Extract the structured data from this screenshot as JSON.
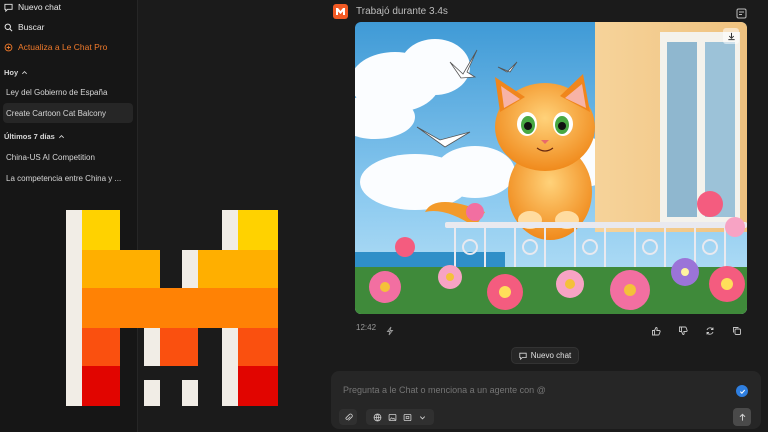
{
  "sidebar": {
    "new_chat": "Nuevo chat",
    "search": "Buscar",
    "upgrade": "Actualiza a Le Chat Pro",
    "today_label": "Hoy",
    "today_items": [
      "Ley del Gobierno de España",
      "Create Cartoon Cat Balcony"
    ],
    "last7_label": "Últimos 7 días",
    "last7_items": [
      "China-US AI Competition",
      "La competencia entre China y ..."
    ]
  },
  "header": {
    "status": "Trabajó durante 3.4s"
  },
  "message": {
    "timestamp": "12:42"
  },
  "new_chat_button": "Nuevo chat",
  "composer": {
    "placeholder": "Pregunta a le Chat o menciona a un agente con @"
  },
  "colors": {
    "brand": "#f25a24",
    "accent_pro": "#f07a2b",
    "check": "#2f7fe0"
  },
  "icons": [
    "chat-icon",
    "search-icon",
    "pro-icon",
    "chevron-up-icon",
    "canvas-icon",
    "download-icon",
    "lightning-icon",
    "thumbs-up-icon",
    "thumbs-down-icon",
    "regenerate-icon",
    "copy-icon",
    "attach-icon",
    "globe-icon",
    "image-icon",
    "code-icon",
    "chevron-down-icon",
    "send-icon"
  ]
}
